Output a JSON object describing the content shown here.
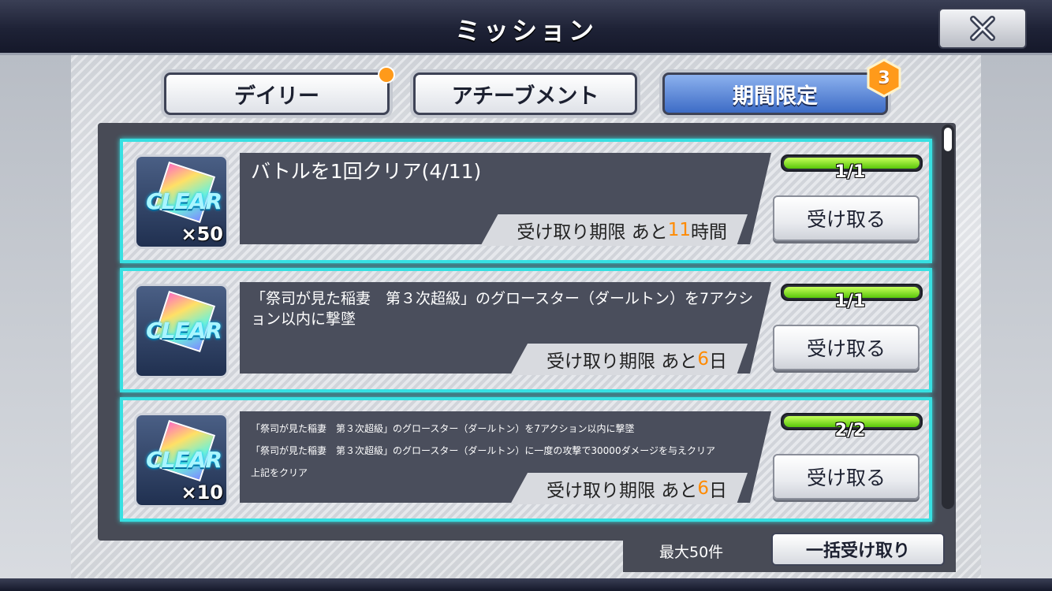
{
  "header": {
    "title": "ミッション",
    "close_icon": "close-icon"
  },
  "tabs": [
    {
      "label": "デイリー",
      "has_notification_dot": true
    },
    {
      "label": "アチーブメント"
    },
    {
      "label": "期間限定",
      "active": true,
      "badge": "3"
    }
  ],
  "colors": {
    "accent_cyan": "#37e0e2",
    "deadline_number": "#ff8a00",
    "active_tab": "#3d6cc6",
    "badge": "#ff9a1a"
  },
  "missions": [
    {
      "reward_label": "CLEAR",
      "reward_qty": "×50",
      "description": "バトルを1回クリア(4/11)",
      "deadline_prefix": "受け取り期限 あと",
      "deadline_value": "11",
      "deadline_unit": "時間",
      "progress_text": "1/1",
      "progress": 1.0,
      "claim_label": "受け取る"
    },
    {
      "reward_label": "CLEAR",
      "reward_qty": "",
      "description": "「祭司が見た稲妻　第３次超級」のグロースター（ダールトン）を7アクション以内に撃墜",
      "deadline_prefix": "受け取り期限 あと",
      "deadline_value": "6",
      "deadline_unit": "日",
      "progress_text": "1/1",
      "progress": 1.0,
      "claim_label": "受け取る"
    },
    {
      "reward_label": "CLEAR",
      "reward_qty": "×10",
      "description_lines": [
        "「祭司が見た稲妻　第３次超級」のグロースター（ダールトン）を7アクション以内に撃墜",
        "「祭司が見た稲妻　第３次超級」のグロースター（ダールトン）に一度の攻撃で30000ダメージを与えクリア",
        "上記をクリア"
      ],
      "deadline_prefix": "受け取り期限 あと",
      "deadline_value": "6",
      "deadline_unit": "日",
      "progress_text": "2/2",
      "progress": 1.0,
      "claim_label": "受け取る"
    }
  ],
  "footer": {
    "max_count": "最大50件",
    "bulk_claim_label": "一括受け取り"
  }
}
